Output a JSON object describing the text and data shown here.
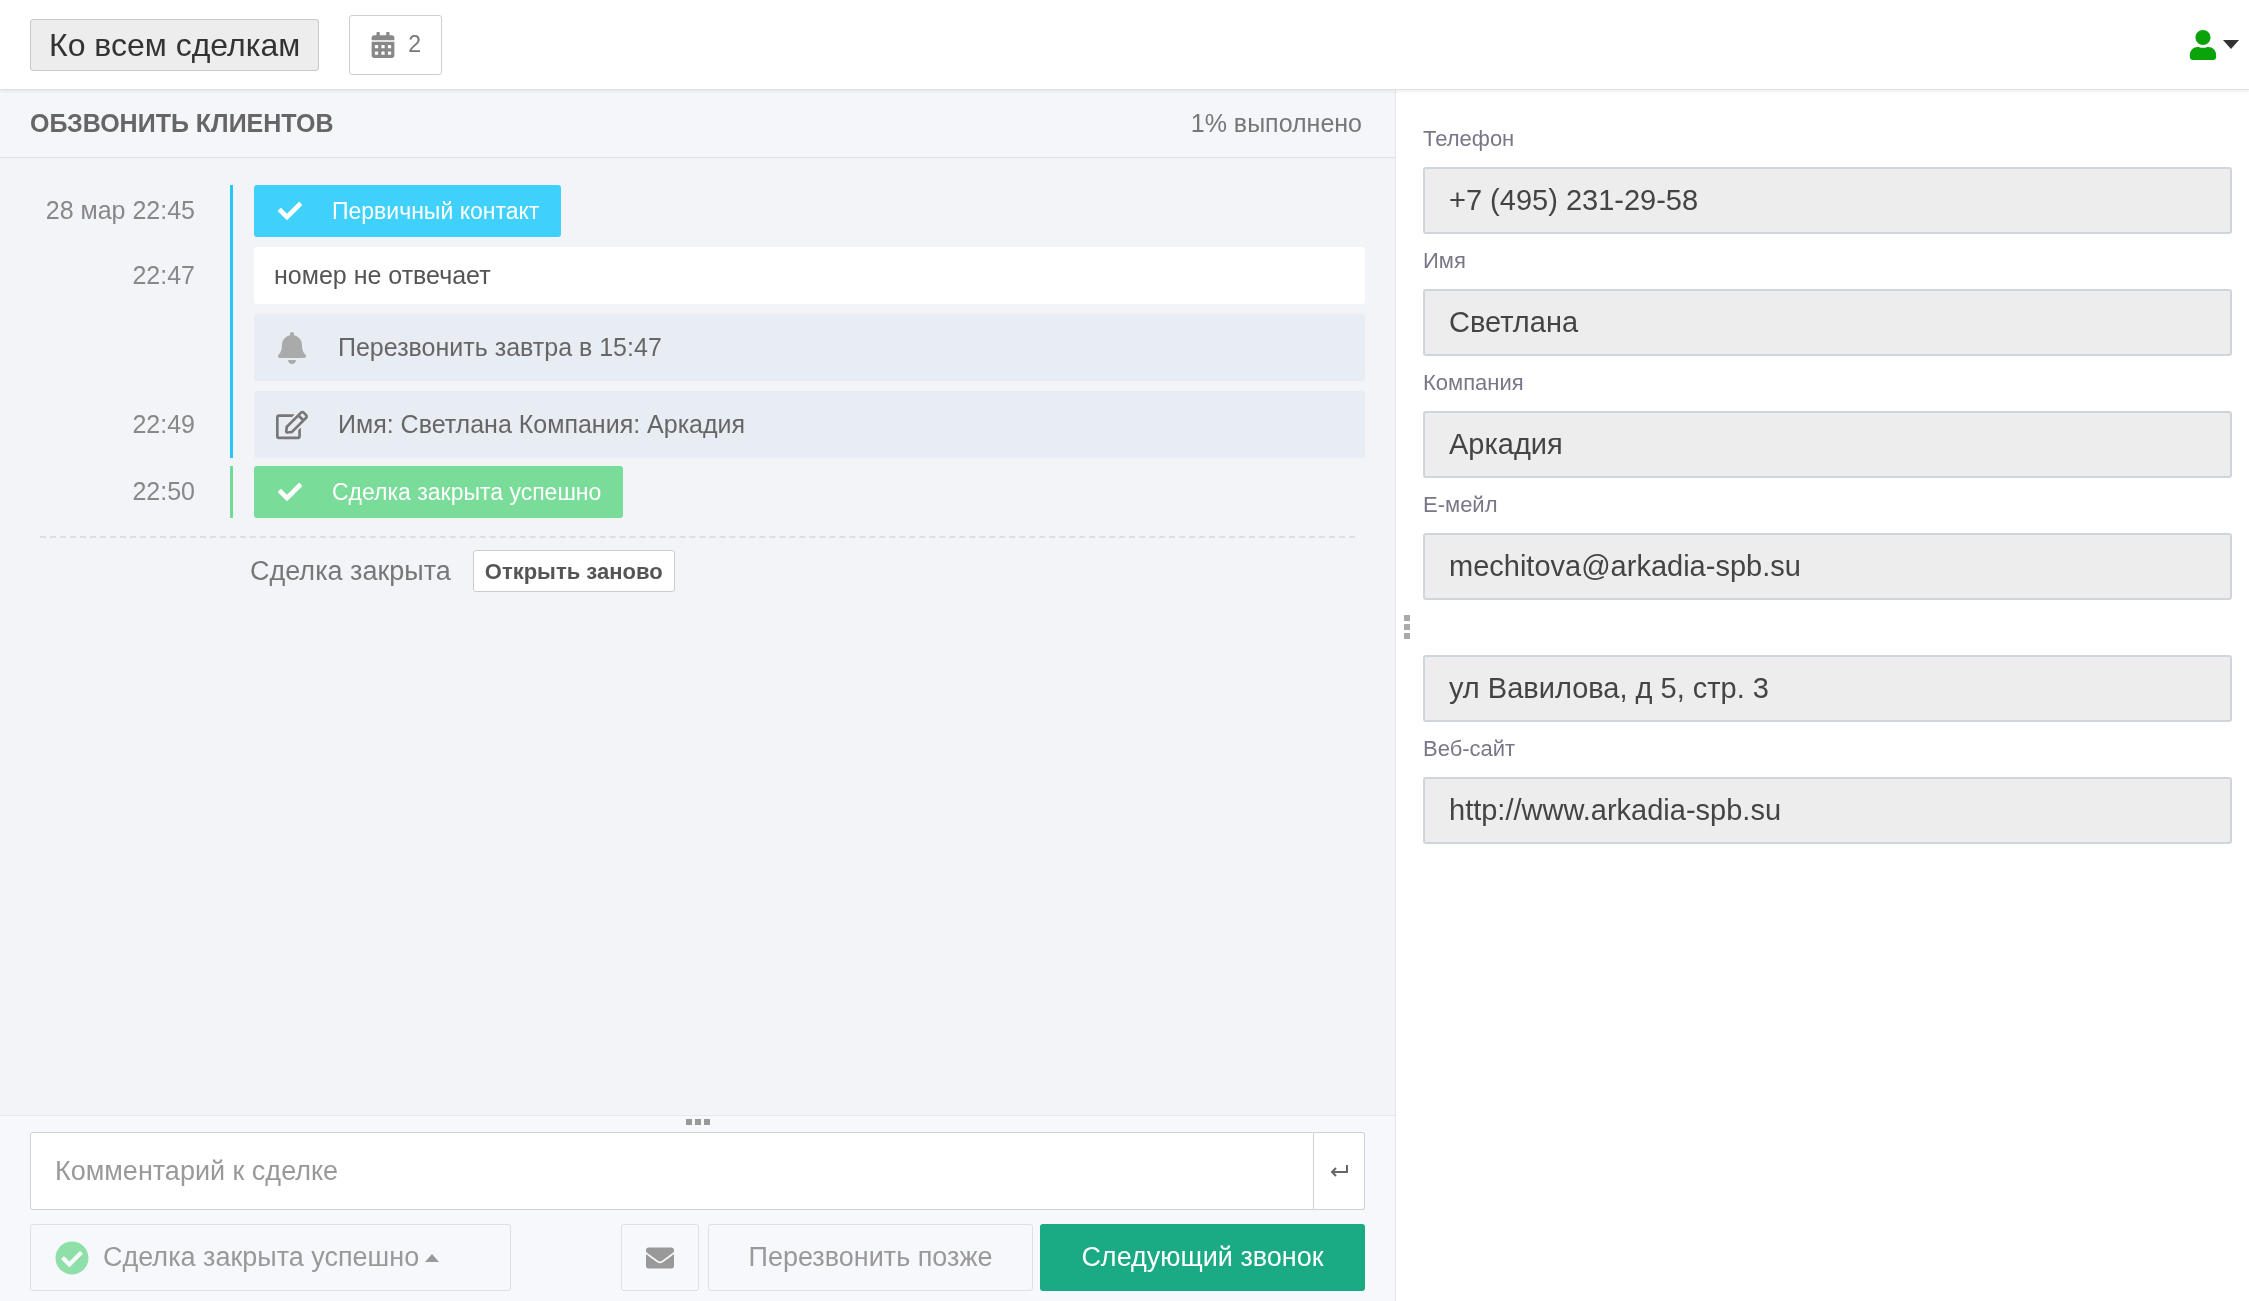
{
  "topbar": {
    "back_button": "Ко всем сделкам",
    "calendar_count": "2"
  },
  "task": {
    "title": "ОБЗВОНИТЬ КЛИЕНТОВ",
    "progress": "1% выполнено"
  },
  "timeline": [
    {
      "color": "#29c5f6",
      "entries": [
        {
          "time": "28 мар 22:45",
          "kind": "tag",
          "text": "Первичный контакт",
          "color": "#3fd0fb"
        },
        {
          "time": "22:47",
          "kind": "comment",
          "text": "номер не отвечает"
        },
        {
          "kind": "reminder",
          "text": "Перезвонить завтра в 15:47"
        },
        {
          "time": "22:49",
          "kind": "edit",
          "text": "Имя: Светлана Компания: Аркадия"
        }
      ]
    },
    {
      "color": "#6fd996",
      "entries": [
        {
          "time": "22:50",
          "kind": "tag",
          "text": "Сделка закрыта успешно",
          "color": "#79dc98"
        }
      ]
    }
  ],
  "closed": {
    "label": "Сделка закрыта",
    "reopen_button": "Открыть заново"
  },
  "comment": {
    "placeholder": "Комментарий к сделке"
  },
  "actions": {
    "status": "Сделка закрыта успешно",
    "later_button": "Перезвонить позже",
    "next_button": "Следующий звонок"
  },
  "contact_fields": [
    {
      "label": "Телефон",
      "value": "+7 (495) 231-29-58"
    },
    {
      "label": "Имя",
      "value": "Светлана"
    },
    {
      "label": "Компания",
      "value": "Аркадия"
    },
    {
      "label": "Е-мейл",
      "value": "mechitova@arkadia-spb.su"
    },
    {
      "value": "ул Вавилова, д 5, стр. 3"
    },
    {
      "label": "Веб-сайт",
      "value": "http://www.arkadia-spb.su"
    }
  ]
}
